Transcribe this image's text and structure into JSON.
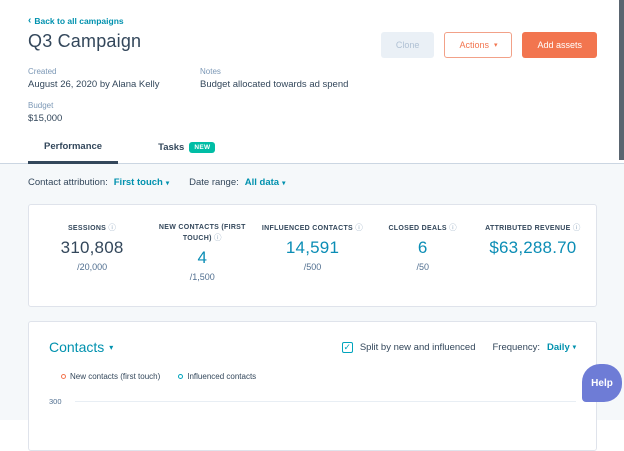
{
  "icons": {
    "chevron_left": "‹",
    "caret_down": "▾",
    "info": "ⓘ",
    "check": "✓"
  },
  "header": {
    "back_link": "Back to all campaigns",
    "title": "Q3 Campaign",
    "created_label": "Created",
    "created_value": "August 26, 2020 by Alana Kelly",
    "notes_label": "Notes",
    "notes_value": "Budget allocated towards ad spend",
    "budget_label": "Budget",
    "budget_value": "$15,000",
    "buttons": {
      "clone": "Clone",
      "actions": "Actions",
      "add_assets": "Add assets"
    }
  },
  "tabs": {
    "performance": "Performance",
    "tasks": "Tasks",
    "tasks_badge": "NEW"
  },
  "filters": {
    "contact_attribution_label": "Contact attribution:",
    "contact_attribution_value": "First touch",
    "date_range_label": "Date range:",
    "date_range_value": "All data"
  },
  "stats": [
    {
      "label": "SESSIONS",
      "value": "310,808",
      "goal": "/20,000",
      "emphasis": "dark"
    },
    {
      "label": "NEW CONTACTS (FIRST TOUCH)",
      "value": "4",
      "goal": "/1,500",
      "emphasis": "teal"
    },
    {
      "label": "INFLUENCED CONTACTS",
      "value": "14,591",
      "goal": "/500",
      "emphasis": "teal"
    },
    {
      "label": "CLOSED DEALS",
      "value": "6",
      "goal": "/50",
      "emphasis": "teal"
    },
    {
      "label": "ATTRIBUTED REVENUE",
      "value": "$63,288.70",
      "goal": "",
      "emphasis": "teal"
    }
  ],
  "contacts_section": {
    "title": "Contacts",
    "split_checkbox_label": "Split by new and influenced",
    "split_checked": true,
    "frequency_label": "Frequency:",
    "frequency_value": "Daily",
    "legend": [
      {
        "label": "New contacts (first touch)",
        "color": "#f2754f"
      },
      {
        "label": "Influenced contacts",
        "color": "#00a4bd"
      }
    ],
    "y_axis_top_label": "300"
  },
  "help_button": "Help",
  "colors": {
    "accent_orange": "#f2754f",
    "accent_teal": "#0091ae",
    "badge_green": "#00bda5",
    "text_dark": "#33475b",
    "text_muted": "#7c98b6",
    "content_background": "#f5f8fa",
    "card_border": "#dfe3eb",
    "help_purple": "#6e7cd6"
  }
}
